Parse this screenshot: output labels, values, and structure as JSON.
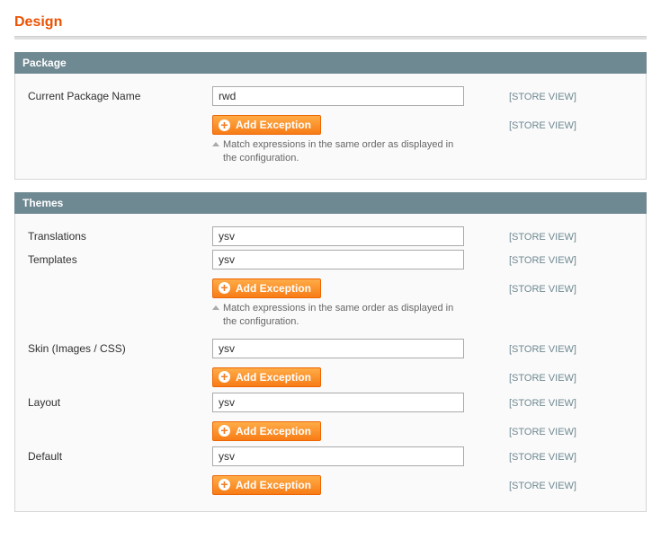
{
  "page": {
    "title": "Design"
  },
  "scope_label": "[STORE VIEW]",
  "buttons": {
    "add_exception": "Add Exception"
  },
  "notes": {
    "match_order": "Match expressions in the same order as displayed in the configuration."
  },
  "package": {
    "legend": "Package",
    "fields": {
      "current_package_name": {
        "label": "Current Package Name",
        "value": "rwd"
      }
    }
  },
  "themes": {
    "legend": "Themes",
    "fields": {
      "translations": {
        "label": "Translations",
        "value": "ysv"
      },
      "templates": {
        "label": "Templates",
        "value": "ysv"
      },
      "skin": {
        "label": "Skin (Images / CSS)",
        "value": "ysv"
      },
      "layout": {
        "label": "Layout",
        "value": "ysv"
      },
      "default": {
        "label": "Default",
        "value": "ysv"
      }
    }
  }
}
